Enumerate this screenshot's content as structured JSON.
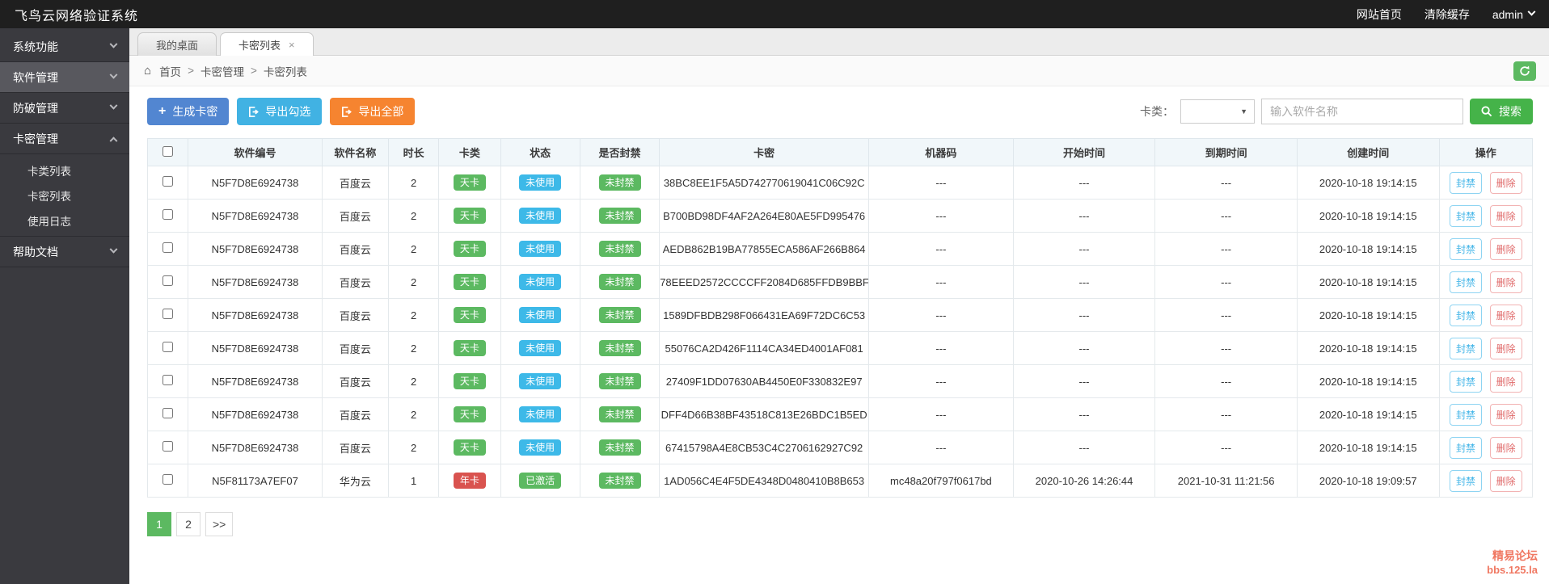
{
  "topbar": {
    "title": "飞鸟云网络验证系统",
    "links": [
      {
        "label": "网站首页"
      },
      {
        "label": "清除缓存"
      }
    ],
    "user": "admin"
  },
  "sidebar": {
    "items": [
      {
        "label": "系统功能",
        "expanded": false
      },
      {
        "label": "软件管理",
        "expanded": false
      },
      {
        "label": "防破管理",
        "expanded": false
      },
      {
        "label": "卡密管理",
        "expanded": true,
        "children": [
          "卡类列表",
          "卡密列表",
          "使用日志"
        ]
      },
      {
        "label": "帮助文档",
        "expanded": false
      }
    ]
  },
  "tabs": [
    {
      "label": "我的桌面",
      "active": false
    },
    {
      "label": "卡密列表",
      "active": true,
      "closable": true
    }
  ],
  "breadcrumb": {
    "items": [
      "首页",
      "卡密管理",
      "卡密列表"
    ],
    "separator": ">"
  },
  "toolbar": {
    "generate_label": "生成卡密",
    "export_checked_label": "导出勾选",
    "export_all_label": "导出全部",
    "filter_label": "卡类：",
    "select_value": "",
    "search_placeholder": "输入软件名称",
    "search_label": "搜索"
  },
  "table": {
    "headers": [
      "软件编号",
      "软件名称",
      "时长",
      "卡类",
      "状态",
      "是否封禁",
      "卡密",
      "机器码",
      "开始时间",
      "到期时间",
      "创建时间",
      "操作"
    ],
    "action_ban": "封禁",
    "action_delete": "删除",
    "rows": [
      {
        "software_id": "N5F7D8E6924738",
        "software_name": "百度云",
        "duration": "2",
        "card_type": {
          "text": "天卡",
          "color": "green"
        },
        "status": {
          "text": "未使用",
          "color": "blue"
        },
        "banned": {
          "text": "未封禁",
          "color": "green"
        },
        "card_key": "38BC8EE1F5A5D742770619041C06C92C",
        "machine_code": "---",
        "start_time": "---",
        "expire_time": "---",
        "create_time": "2020-10-18 19:14:15"
      },
      {
        "software_id": "N5F7D8E6924738",
        "software_name": "百度云",
        "duration": "2",
        "card_type": {
          "text": "天卡",
          "color": "green"
        },
        "status": {
          "text": "未使用",
          "color": "blue"
        },
        "banned": {
          "text": "未封禁",
          "color": "green"
        },
        "card_key": "B700BD98DF4AF2A264E80AE5FD995476",
        "machine_code": "---",
        "start_time": "---",
        "expire_time": "---",
        "create_time": "2020-10-18 19:14:15"
      },
      {
        "software_id": "N5F7D8E6924738",
        "software_name": "百度云",
        "duration": "2",
        "card_type": {
          "text": "天卡",
          "color": "green"
        },
        "status": {
          "text": "未使用",
          "color": "blue"
        },
        "banned": {
          "text": "未封禁",
          "color": "green"
        },
        "card_key": "AEDB862B19BA77855ECA586AF266B864",
        "machine_code": "---",
        "start_time": "---",
        "expire_time": "---",
        "create_time": "2020-10-18 19:14:15"
      },
      {
        "software_id": "N5F7D8E6924738",
        "software_name": "百度云",
        "duration": "2",
        "card_type": {
          "text": "天卡",
          "color": "green"
        },
        "status": {
          "text": "未使用",
          "color": "blue"
        },
        "banned": {
          "text": "未封禁",
          "color": "green"
        },
        "card_key": "78EEED2572CCCCFF2084D685FFDB9BBF",
        "machine_code": "---",
        "start_time": "---",
        "expire_time": "---",
        "create_time": "2020-10-18 19:14:15"
      },
      {
        "software_id": "N5F7D8E6924738",
        "software_name": "百度云",
        "duration": "2",
        "card_type": {
          "text": "天卡",
          "color": "green"
        },
        "status": {
          "text": "未使用",
          "color": "blue"
        },
        "banned": {
          "text": "未封禁",
          "color": "green"
        },
        "card_key": "1589DFBDB298F066431EA69F72DC6C53",
        "machine_code": "---",
        "start_time": "---",
        "expire_time": "---",
        "create_time": "2020-10-18 19:14:15"
      },
      {
        "software_id": "N5F7D8E6924738",
        "software_name": "百度云",
        "duration": "2",
        "card_type": {
          "text": "天卡",
          "color": "green"
        },
        "status": {
          "text": "未使用",
          "color": "blue"
        },
        "banned": {
          "text": "未封禁",
          "color": "green"
        },
        "card_key": "55076CA2D426F1114CA34ED4001AF081",
        "machine_code": "---",
        "start_time": "---",
        "expire_time": "---",
        "create_time": "2020-10-18 19:14:15"
      },
      {
        "software_id": "N5F7D8E6924738",
        "software_name": "百度云",
        "duration": "2",
        "card_type": {
          "text": "天卡",
          "color": "green"
        },
        "status": {
          "text": "未使用",
          "color": "blue"
        },
        "banned": {
          "text": "未封禁",
          "color": "green"
        },
        "card_key": "27409F1DD07630AB4450E0F330832E97",
        "machine_code": "---",
        "start_time": "---",
        "expire_time": "---",
        "create_time": "2020-10-18 19:14:15"
      },
      {
        "software_id": "N5F7D8E6924738",
        "software_name": "百度云",
        "duration": "2",
        "card_type": {
          "text": "天卡",
          "color": "green"
        },
        "status": {
          "text": "未使用",
          "color": "blue"
        },
        "banned": {
          "text": "未封禁",
          "color": "green"
        },
        "card_key": "DFF4D66B38BF43518C813E26BDC1B5ED",
        "machine_code": "---",
        "start_time": "---",
        "expire_time": "---",
        "create_time": "2020-10-18 19:14:15"
      },
      {
        "software_id": "N5F7D8E6924738",
        "software_name": "百度云",
        "duration": "2",
        "card_type": {
          "text": "天卡",
          "color": "green"
        },
        "status": {
          "text": "未使用",
          "color": "blue"
        },
        "banned": {
          "text": "未封禁",
          "color": "green"
        },
        "card_key": "67415798A4E8CB53C4C2706162927C92",
        "machine_code": "---",
        "start_time": "---",
        "expire_time": "---",
        "create_time": "2020-10-18 19:14:15"
      },
      {
        "software_id": "N5F81173A7EF07",
        "software_name": "华为云",
        "duration": "1",
        "card_type": {
          "text": "年卡",
          "color": "red"
        },
        "status": {
          "text": "已激活",
          "color": "green"
        },
        "banned": {
          "text": "未封禁",
          "color": "green"
        },
        "card_key": "1AD056C4E4F5DE4348D0480410B8B653",
        "machine_code": "mc48a20f797f0617bd",
        "start_time": "2020-10-26 14:26:44",
        "expire_time": "2021-10-31 11:21:56",
        "create_time": "2020-10-18 19:09:57"
      }
    ]
  },
  "pagination": {
    "pages": [
      "1",
      "2"
    ],
    "active": "1",
    "next": ">>"
  },
  "footer": {
    "line1": "精易论坛",
    "line2": "bbs.125.la"
  },
  "colors": {
    "topbar_bg": "#1f1f1f",
    "sidebar_bg": "#3a3a3f",
    "sidebar_active_bg": "#58585e",
    "green": "#5cb961",
    "blue": "#3db9e8",
    "red": "#d9534f",
    "btn_primary": "#5286d1",
    "btn_info": "#41b2e3",
    "btn_warning": "#f68430",
    "btn_search": "#45b349",
    "header_bg": "#f1f7fa",
    "watermark": "#f07862",
    "action_ban": "#45b6e8",
    "action_del": "#e06a6a"
  }
}
